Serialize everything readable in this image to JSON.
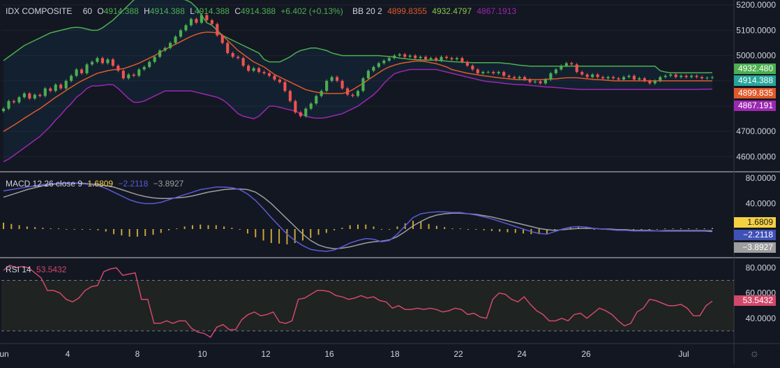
{
  "legend_main": {
    "symbol": "IDX COMPOSITE",
    "interval": "60",
    "o_label": "O",
    "o_val": "4914.388",
    "h_label": "H",
    "h_val": "4914.388",
    "l_label": "L",
    "l_val": "4914.388",
    "c_label": "C",
    "c_val": "4914.388",
    "change": "+6.402 (+0.13%)",
    "bb_label": "BB 20 2",
    "bb_basis": "4899.8355",
    "bb_upper": "4932.4797",
    "bb_lower": "4867.1913"
  },
  "legend_macd": {
    "label": "MACD 12 26 close 9",
    "hist": "1.6809",
    "macd": "−2.2118",
    "signal": "−3.8927"
  },
  "legend_rsi": {
    "label": "RSI 14",
    "value": "53.5432"
  },
  "badges": {
    "bb_upper": "4932.480",
    "price": "4914.388",
    "bb_basis": "4899.835",
    "bb_lower": "4867.191",
    "macd_hist": "1.6809",
    "macd": "−2.2118",
    "signal": "−3.8927",
    "rsi": "53.5432"
  },
  "colors": {
    "background": "#131722",
    "grid": "#1f2330",
    "up": "#26a69a",
    "up_bright": "#4caf50",
    "down": "#ef5350",
    "bb_basis": "#e0592a",
    "bb_upper": "#4caf50",
    "bb_lower": "#9c27b0",
    "macd": "#5b5bd6",
    "signal": "#9e9e9e",
    "hist": "#c8a536",
    "rsi": "#d2486a"
  },
  "settings_icon": "gear-icon",
  "chart_data": [
    {
      "type": "candlestick",
      "name": "IDX COMPOSITE",
      "ylim": [
        4540,
        5220
      ],
      "y_ticks": [
        "5200.0000",
        "5100.0000",
        "5000.0000",
        "4900.0000",
        "4800.0000",
        "4700.0000",
        "4600.0000"
      ],
      "x_ticks": [
        "un",
        "4",
        "8",
        "10",
        "12",
        "16",
        "18",
        "22",
        "24",
        "26",
        "Jul"
      ],
      "close": [
        4790,
        4820,
        4815,
        4835,
        4850,
        4830,
        4845,
        4840,
        4870,
        4860,
        4885,
        4870,
        4900,
        4920,
        4945,
        4930,
        4965,
        4975,
        4990,
        4970,
        4985,
        4960,
        4940,
        4910,
        4925,
        4920,
        4945,
        4955,
        4975,
        4995,
        5020,
        5030,
        5050,
        5075,
        5100,
        5120,
        5145,
        5130,
        5160,
        5140,
        5125,
        5080,
        5050,
        5010,
        4995,
        4990,
        4960,
        4940,
        4950,
        4935,
        4930,
        4920,
        4905,
        4895,
        4860,
        4820,
        4775,
        4760,
        4790,
        4810,
        4840,
        4860,
        4900,
        4915,
        4900,
        4870,
        4845,
        4840,
        4860,
        4910,
        4940,
        4955,
        4970,
        4980,
        4990,
        5000,
        5005,
        4995,
        5000,
        4990,
        4995,
        4985,
        4990,
        4980,
        4995,
        4990,
        4985,
        4990,
        4975,
        4960,
        4945,
        4930,
        4935,
        4935,
        4930,
        4935,
        4920,
        4915,
        4910,
        4915,
        4905,
        4895,
        4898,
        4890,
        4905,
        4930,
        4945,
        4960,
        4970,
        4965,
        4935,
        4925,
        4915,
        4925,
        4915,
        4910,
        4915,
        4910,
        4905,
        4915,
        4920,
        4905,
        4910,
        4900,
        4890,
        4900,
        4915,
        4920,
        4925,
        4915,
        4920,
        4915,
        4920,
        4915,
        4910,
        4912,
        4914.388
      ],
      "bb_basis": [
        4700,
        4712,
        4725,
        4738,
        4752,
        4765,
        4778,
        4790,
        4805,
        4820,
        4835,
        4848,
        4862,
        4875,
        4888,
        4900,
        4910,
        4920,
        4930,
        4935,
        4940,
        4944,
        4946,
        4948,
        4955,
        4962,
        4970,
        4980,
        4990,
        5000,
        5012,
        5024,
        5035,
        5045,
        5055,
        5066,
        5076,
        5084,
        5090,
        5093,
        5092,
        5090,
        5080,
        5060,
        5040,
        5020,
        5005,
        4990,
        4975,
        4965,
        4955,
        4940,
        4925,
        4915,
        4905,
        4895,
        4885,
        4875,
        4865,
        4860,
        4855,
        4852,
        4850,
        4850,
        4850,
        4850,
        4855,
        4865,
        4878,
        4890,
        4905,
        4918,
        4932,
        4945,
        4955,
        4962,
        4968,
        4972,
        4975,
        4978,
        4978,
        4976,
        4972,
        4968,
        4962,
        4955,
        4945,
        4940,
        4935,
        4930,
        4927,
        4924,
        4920,
        4918,
        4915,
        4912,
        4910,
        4908,
        4906,
        4905,
        4905,
        4905,
        4905,
        4905,
        4906,
        4907,
        4908,
        4910,
        4912,
        4912,
        4912,
        4910,
        4908,
        4906,
        4905,
        4904,
        4902,
        4900,
        4900,
        4900,
        4900,
        4900,
        4900,
        4900,
        4900,
        4900,
        4900,
        4900,
        4900,
        4900,
        4900,
        4900,
        4900,
        4900,
        4900,
        4900,
        4899.8355
      ],
      "bb_upper": [
        4980,
        4995,
        5010,
        5025,
        5040,
        5050,
        5060,
        5070,
        5080,
        5090,
        5095,
        5100,
        5105,
        5110,
        5112,
        5110,
        5105,
        5100,
        5100,
        5110,
        5125,
        5140,
        5160,
        5180,
        5200,
        5220,
        5230,
        5230,
        5230,
        5230,
        5230,
        5230,
        5230,
        5228,
        5225,
        5220,
        5210,
        5190,
        5160,
        5130,
        5120,
        5100,
        5080,
        5070,
        5060,
        5050,
        5040,
        5030,
        5020,
        5010,
        4985,
        4975,
        4975,
        4975,
        4985,
        4995,
        5010,
        5020,
        5025,
        5030,
        5030,
        5025,
        5020,
        5010,
        5005,
        5000,
        5000,
        5000,
        5000,
        5000,
        5000,
        5000,
        5000,
        4998,
        4996,
        4994,
        4990,
        4988,
        4985,
        4984,
        4983,
        4982,
        4982,
        4982,
        4980,
        4978,
        4976,
        4975,
        4974,
        4973,
        4972,
        4972,
        4972,
        4972,
        4972,
        4972,
        4970,
        4968,
        4965,
        4962,
        4960,
        4958,
        4958,
        4958,
        4958,
        4958,
        4958,
        4958,
        4958,
        4958,
        4958,
        4958,
        4958,
        4958,
        4958,
        4958,
        4958,
        4958,
        4958,
        4958,
        4958,
        4958,
        4958,
        4958,
        4958,
        4958,
        4940,
        4935,
        4932,
        4932,
        4932,
        4932,
        4932,
        4932,
        4932,
        4932,
        4932.4797
      ],
      "bb_lower": [
        4580,
        4590,
        4605,
        4620,
        4635,
        4650,
        4665,
        4680,
        4700,
        4720,
        4745,
        4765,
        4790,
        4810,
        4835,
        4850,
        4870,
        4880,
        4880,
        4882,
        4885,
        4885,
        4870,
        4850,
        4830,
        4815,
        4815,
        4820,
        4830,
        4840,
        4850,
        4860,
        4860,
        4860,
        4860,
        4860,
        4860,
        4855,
        4850,
        4845,
        4840,
        4835,
        4825,
        4810,
        4790,
        4770,
        4760,
        4755,
        4750,
        4760,
        4780,
        4800,
        4800,
        4795,
        4790,
        4785,
        4780,
        4770,
        4760,
        4755,
        4752,
        4752,
        4755,
        4760,
        4765,
        4770,
        4780,
        4790,
        4800,
        4815,
        4830,
        4845,
        4865,
        4890,
        4910,
        4928,
        4935,
        4940,
        4945,
        4945,
        4945,
        4945,
        4945,
        4945,
        4940,
        4935,
        4930,
        4925,
        4920,
        4915,
        4910,
        4905,
        4900,
        4897,
        4895,
        4893,
        4890,
        4888,
        4886,
        4885,
        4884,
        4882,
        4880,
        4878,
        4876,
        4875,
        4873,
        4872,
        4870,
        4868,
        4867,
        4866,
        4866,
        4866,
        4866,
        4866,
        4866,
        4866,
        4866,
        4866,
        4866,
        4866,
        4866,
        4866,
        4866,
        4866,
        4866,
        4866,
        4866,
        4866,
        4866,
        4866,
        4866,
        4866,
        4867,
        4867,
        4867.1913
      ]
    },
    {
      "type": "macd",
      "name": "MACD 12 26 close 9",
      "ylim": [
        -45,
        90
      ],
      "y_ticks": [
        "80.0000",
        "40.0000"
      ],
      "macd": [
        60,
        62,
        64,
        66,
        68,
        70,
        71,
        72,
        72,
        72,
        71,
        70,
        68,
        64,
        58,
        52,
        46,
        42,
        40,
        40,
        42,
        46,
        50,
        54,
        58,
        62,
        64,
        66,
        66,
        65,
        62,
        55,
        45,
        32,
        18,
        5,
        -8,
        -18,
        -26,
        -32,
        -34,
        -35,
        -33,
        -28,
        -22,
        -18,
        -15,
        -16,
        -20,
        -18,
        -8,
        5,
        18,
        24,
        26,
        27,
        27,
        26,
        26,
        24,
        22,
        19,
        16,
        12,
        8,
        4,
        0,
        -4,
        -7,
        -8,
        -4,
        0,
        3,
        4,
        3,
        1,
        0,
        -1,
        -2,
        -2,
        -3,
        -3,
        -3,
        -3,
        -2,
        -2,
        -2,
        -2,
        -2,
        -2,
        -2.2118
      ],
      "signal": [
        50,
        54,
        58,
        62,
        65,
        68,
        70,
        71,
        72,
        72,
        72,
        71,
        70,
        68,
        66,
        62,
        58,
        54,
        51,
        49,
        48,
        48,
        49,
        50,
        52,
        55,
        58,
        60,
        62,
        63,
        63,
        62,
        58,
        50,
        40,
        28,
        16,
        4,
        -8,
        -18,
        -25,
        -29,
        -31,
        -30,
        -28,
        -25,
        -22,
        -20,
        -19,
        -17,
        -12,
        -4,
        5,
        12,
        18,
        22,
        24,
        25,
        25,
        24,
        23,
        21,
        19,
        16,
        13,
        10,
        7,
        4,
        1,
        -1,
        -2,
        -1,
        0,
        1,
        1,
        1,
        0,
        0,
        -1,
        -1,
        -2,
        -2,
        -2,
        -3,
        -3,
        -3,
        -3,
        -3,
        -3,
        -3,
        -3.8927
      ],
      "hist": [
        10,
        8,
        6,
        4,
        3,
        2,
        1,
        1,
        0,
        0,
        -1,
        -1,
        -2,
        -4,
        -8,
        -10,
        -12,
        -12,
        -11,
        -9,
        -6,
        -2,
        1,
        4,
        6,
        7,
        6,
        6,
        4,
        2,
        -1,
        -7,
        -13,
        -18,
        -22,
        -23,
        -24,
        -22,
        -18,
        -14,
        -9,
        -6,
        -2,
        2,
        6,
        7,
        7,
        4,
        -1,
        -1,
        4,
        9,
        13,
        12,
        8,
        5,
        3,
        1,
        1,
        0,
        -1,
        -2,
        -3,
        -4,
        -5,
        -6,
        -7,
        -8,
        -8,
        -7,
        -2,
        1,
        3,
        3,
        2,
        0,
        0,
        -1,
        -1,
        -1,
        -1,
        -1,
        -1,
        0,
        1,
        1,
        1,
        1,
        1,
        1,
        1.6809
      ]
    },
    {
      "type": "line",
      "name": "RSI 14",
      "ylim": [
        20,
        88
      ],
      "bands": [
        30,
        70
      ],
      "y_ticks": [
        "80.0000",
        "60.0000",
        "40.0000"
      ],
      "values": [
        78,
        82,
        80,
        81,
        80,
        76,
        72,
        62,
        62,
        60,
        55,
        53,
        56,
        62,
        65,
        66,
        77,
        79,
        80,
        74,
        75,
        76,
        55,
        55,
        36,
        36,
        38,
        36,
        38,
        38,
        32,
        29,
        28,
        25,
        33,
        35,
        31,
        31,
        39,
        43,
        45,
        42,
        43,
        45,
        37,
        36,
        38,
        55,
        56,
        59,
        62,
        62,
        61,
        58,
        57,
        55,
        56,
        58,
        56,
        57,
        54,
        53,
        48,
        50,
        47,
        47,
        48,
        47,
        48,
        47,
        45,
        46,
        48,
        47,
        43,
        44,
        41,
        40,
        55,
        60,
        59,
        55,
        53,
        57,
        51,
        46,
        43,
        38,
        38,
        40,
        38,
        43,
        44,
        40,
        44,
        48,
        46,
        43,
        38,
        34,
        36,
        45,
        48,
        55,
        54,
        52,
        50,
        50,
        51,
        48,
        42,
        42,
        50,
        53.5432
      ]
    }
  ]
}
